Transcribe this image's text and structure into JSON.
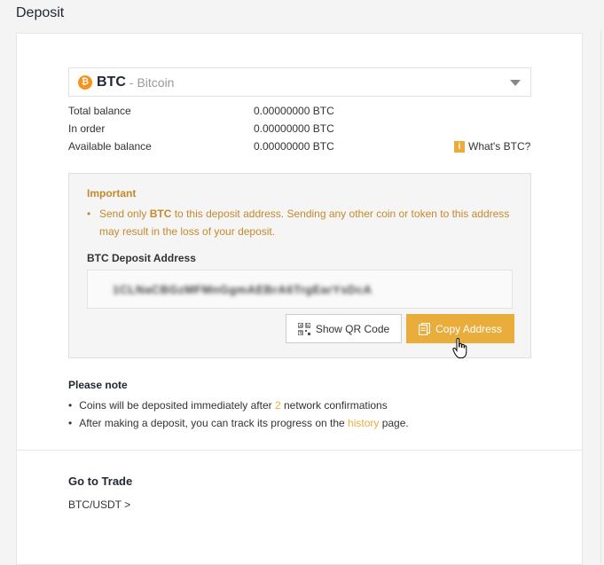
{
  "page": {
    "title": "Deposit"
  },
  "coin_select": {
    "symbol": "BTC",
    "separator_name": "- Bitcoin",
    "icon": "bitcoin-icon"
  },
  "balances": [
    {
      "label": "Total balance",
      "value": "0.00000000 BTC"
    },
    {
      "label": "In order",
      "value": "0.00000000 BTC"
    },
    {
      "label": "Available balance",
      "value": "0.00000000 BTC"
    }
  ],
  "whats_btc": {
    "icon": "info-icon",
    "icon_glyph": "i",
    "label": "What's BTC?"
  },
  "important": {
    "title": "Important",
    "text_before": "Send only ",
    "coin": "BTC",
    "text_after": " to this deposit address. Sending any other coin or token to this address may result in the loss of your deposit."
  },
  "deposit_address": {
    "label": "BTC Deposit Address",
    "value": "1CLNaCBGzMFMnGgmAEBrA6TrgEarYsDcA"
  },
  "buttons": {
    "qr": {
      "label": "Show QR Code",
      "icon": "qr-code-icon"
    },
    "copy": {
      "label": "Copy Address",
      "icon": "copy-icon"
    }
  },
  "please_note": {
    "title": "Please note",
    "item1_before": "Coins will be deposited immediately after ",
    "item1_count": "2",
    "item1_after": " network confirmations",
    "item2_before": "After making a deposit, you can track its progress on the ",
    "item2_link": "history",
    "item2_after": " page."
  },
  "trade": {
    "title": "Go to Trade",
    "link": "BTC/USDT >"
  },
  "colors": {
    "accent": "#e9ad3c",
    "warning_text": "#c5892b",
    "btc_orange": "#f7931a"
  }
}
